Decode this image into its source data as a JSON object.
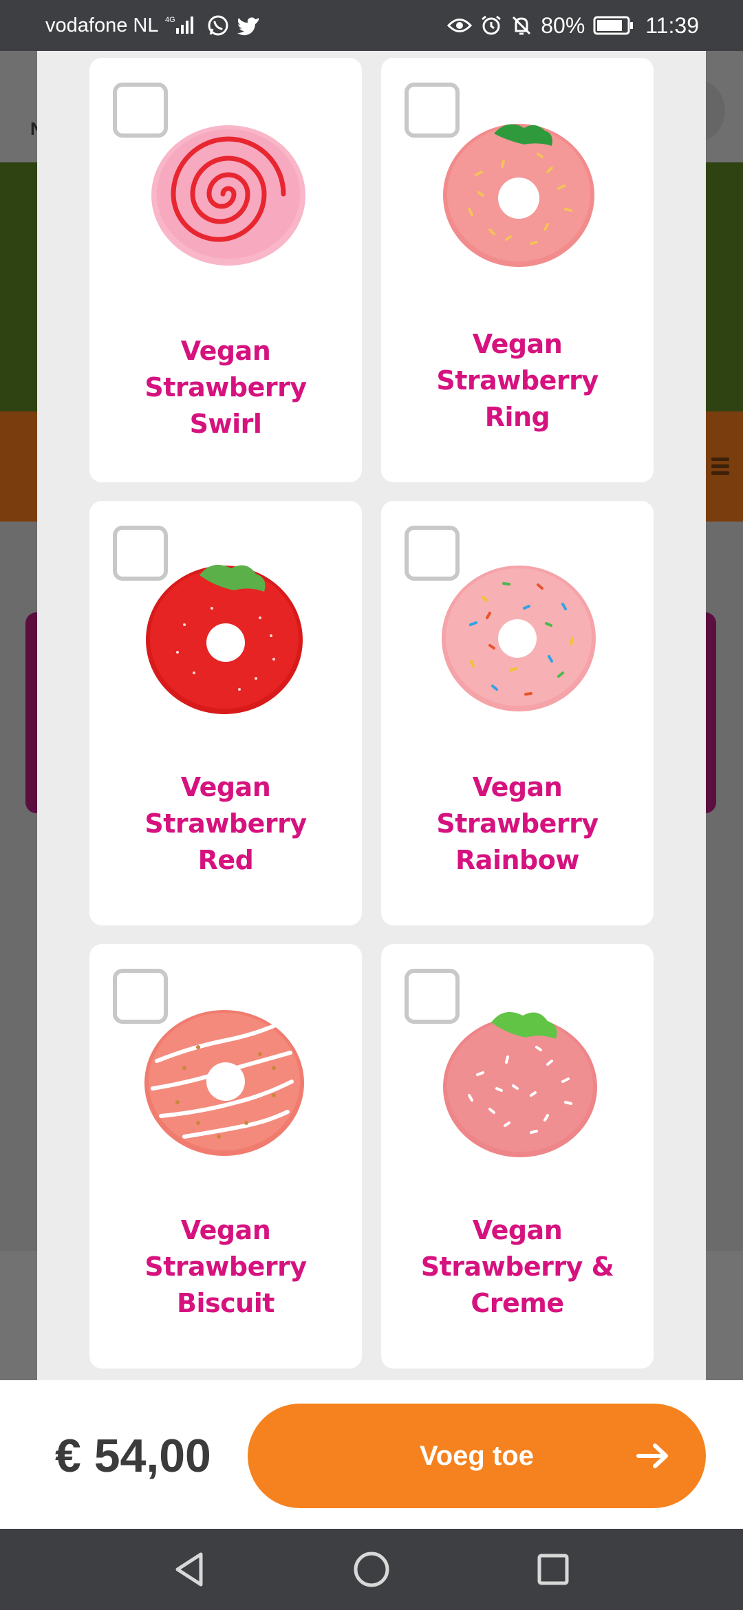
{
  "status_bar": {
    "carrier": "vodafone NL",
    "network": "4G",
    "battery_percent": "80%",
    "time": "11:39",
    "icons": [
      "signal-icon",
      "whatsapp-icon",
      "twitter-icon",
      "eye-icon",
      "alarm-icon",
      "bell-off-icon",
      "battery-icon"
    ]
  },
  "background_page": {
    "header_letter": "N"
  },
  "modal": {
    "products": [
      {
        "name": "Vegan Strawberry Swirl",
        "lines": [
          "Vegan",
          "Strawberry",
          "Swirl"
        ],
        "checked": false,
        "image": "strawberry-swirl-donut"
      },
      {
        "name": "Vegan Strawberry Ring",
        "lines": [
          "Vegan",
          "Strawberry",
          "Ring"
        ],
        "checked": false,
        "image": "strawberry-ring-donut"
      },
      {
        "name": "Vegan Strawberry Red",
        "lines": [
          "Vegan",
          "Strawberry",
          "Red"
        ],
        "checked": false,
        "image": "strawberry-red-donut"
      },
      {
        "name": "Vegan Strawberry Rainbow",
        "lines": [
          "Vegan",
          "Strawberry",
          "Rainbow"
        ],
        "checked": false,
        "image": "strawberry-rainbow-donut"
      },
      {
        "name": "Vegan Strawberry Biscuit",
        "lines": [
          "Vegan",
          "Strawberry",
          "Biscuit"
        ],
        "checked": false,
        "image": "strawberry-biscuit-donut"
      },
      {
        "name": "Vegan Strawberry & Creme",
        "lines": [
          "Vegan",
          "Strawberry &",
          "Creme"
        ],
        "checked": false,
        "image": "strawberry-creme-donut"
      }
    ]
  },
  "action_bar": {
    "price": "€ 54,00",
    "add_button_label": "Voeg toe"
  },
  "nav_bar": {
    "buttons": [
      "back-icon",
      "home-icon",
      "recents-icon"
    ]
  },
  "colors": {
    "title_pink": "#d6127f",
    "button_orange": "#f5821f",
    "checkbox_border": "#c8c8c8",
    "modal_bg": "#ececec",
    "system_bar": "#3d3f42"
  }
}
